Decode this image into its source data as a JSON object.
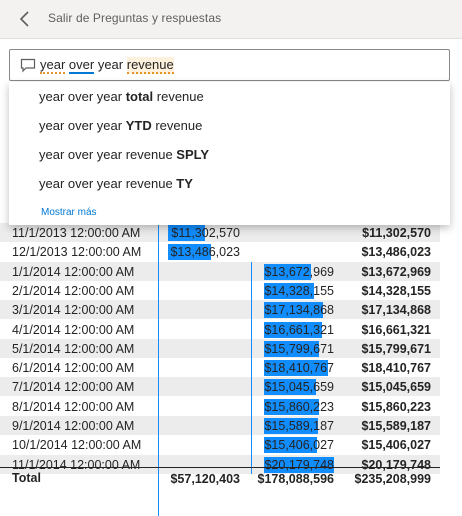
{
  "header": {
    "title": "Salir de Preguntas y respuestas"
  },
  "qa": {
    "tokens": [
      {
        "text": "year",
        "style": "u-orange"
      },
      {
        "text": " ",
        "style": ""
      },
      {
        "text": "over",
        "style": "u-blue"
      },
      {
        "text": " year ",
        "style": ""
      },
      {
        "text": "revenue",
        "style": "hl u-orange"
      }
    ]
  },
  "suggestions": [
    {
      "pre": "year over year ",
      "bold": "total",
      "post": " revenue"
    },
    {
      "pre": "year over year ",
      "bold": "YTD",
      "post": " revenue"
    },
    {
      "pre": "year over year revenue ",
      "bold": "SPLY",
      "post": ""
    },
    {
      "pre": "year over year revenue ",
      "bold": "TY",
      "post": ""
    }
  ],
  "more_label": "Mostrar más",
  "colors": {
    "bar": "#118dff",
    "link": "#0078d4"
  },
  "table": {
    "rows": [
      {
        "date": "11/1/2013 12:00:00 AM",
        "c1": "$11,302,570",
        "c2": "",
        "c3": "$11,302,570"
      },
      {
        "date": "12/1/2013 12:00:00 AM",
        "c1": "$13,486,023",
        "c2": "",
        "c3": "$13,486,023"
      },
      {
        "date": "1/1/2014 12:00:00 AM",
        "c1": "",
        "c2": "$13,672,969",
        "c3": "$13,672,969"
      },
      {
        "date": "2/1/2014 12:00:00 AM",
        "c1": "",
        "c2": "$14,328,155",
        "c3": "$14,328,155"
      },
      {
        "date": "3/1/2014 12:00:00 AM",
        "c1": "",
        "c2": "$17,134,868",
        "c3": "$17,134,868"
      },
      {
        "date": "4/1/2014 12:00:00 AM",
        "c1": "",
        "c2": "$16,661,321",
        "c3": "$16,661,321"
      },
      {
        "date": "5/1/2014 12:00:00 AM",
        "c1": "",
        "c2": "$15,799,671",
        "c3": "$15,799,671"
      },
      {
        "date": "6/1/2014 12:00:00 AM",
        "c1": "",
        "c2": "$18,410,767",
        "c3": "$18,410,767"
      },
      {
        "date": "7/1/2014 12:00:00 AM",
        "c1": "",
        "c2": "$15,045,659",
        "c3": "$15,045,659"
      },
      {
        "date": "8/1/2014 12:00:00 AM",
        "c1": "",
        "c2": "$15,860,223",
        "c3": "$15,860,223"
      },
      {
        "date": "9/1/2014 12:00:00 AM",
        "c1": "",
        "c2": "$15,589,187",
        "c3": "$15,589,187"
      },
      {
        "date": "10/1/2014 12:00:00 AM",
        "c1": "",
        "c2": "$15,406,027",
        "c3": "$15,406,027"
      },
      {
        "date": "11/1/2014 12:00:00 AM",
        "c1": "",
        "c2": "$20,179,748",
        "c3": "$20,179,748"
      }
    ],
    "bar_values": [
      {
        "c1": 11302570,
        "c2": 0
      },
      {
        "c1": 13486023,
        "c2": 0
      },
      {
        "c1": 0,
        "c2": 13672969
      },
      {
        "c1": 0,
        "c2": 14328155
      },
      {
        "c1": 0,
        "c2": 17134868
      },
      {
        "c1": 0,
        "c2": 16661321
      },
      {
        "c1": 0,
        "c2": 15799671
      },
      {
        "c1": 0,
        "c2": 18410767
      },
      {
        "c1": 0,
        "c2": 15045659
      },
      {
        "c1": 0,
        "c2": 15860223
      },
      {
        "c1": 0,
        "c2": 15589187
      },
      {
        "c1": 0,
        "c2": 15406027
      },
      {
        "c1": 0,
        "c2": 20179748
      }
    ],
    "total": {
      "label": "Total",
      "c1": "$57,120,403",
      "c2": "$178,088,596",
      "c3": "$235,208,999"
    }
  }
}
